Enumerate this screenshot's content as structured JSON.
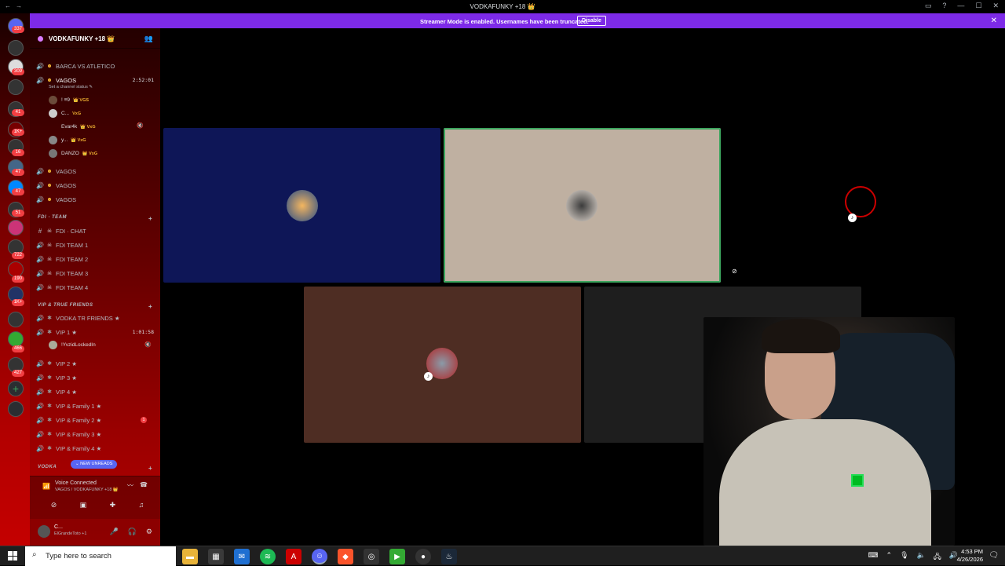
{
  "window": {
    "title": "VODKAFUNKY +18 👑",
    "controls": [
      "▭",
      "?",
      "—",
      "☐",
      "✕"
    ]
  },
  "banner": {
    "text": "Streamer Mode is enabled. Usernames have been truncated.",
    "disable_label": "Disable",
    "close": "✕"
  },
  "rail": {
    "badges": [
      "337",
      "309",
      "41",
      "1K+",
      "16",
      "47",
      "47",
      "51",
      "722",
      "190",
      "1K+",
      "466",
      "427"
    ]
  },
  "guild": {
    "name": "VODKAFUNKY +18 👑",
    "invite_icon": "👥"
  },
  "channels": {
    "barca": {
      "label": "BARCA VS ATLETICO"
    },
    "vagos_active": {
      "label": "VAGOS",
      "time": "2:52:01",
      "status": "Set a channel status ✎"
    },
    "vagos_users": [
      {
        "name": "! ≡9",
        "tag": "👑 VGS"
      },
      {
        "name": "C...",
        "tag": "VxG"
      },
      {
        "name": "Evar4k",
        "tag": "👑 VxG"
      },
      {
        "name": "y...",
        "tag": "👑 VxG"
      },
      {
        "name": "DANZO",
        "tag": "👑 VxG"
      }
    ],
    "vagos2": {
      "label": "VAGOS"
    },
    "vagos3": {
      "label": "VAGOS"
    },
    "vagos4": {
      "label": "VAGOS"
    },
    "fdi_category": "FDI · TEAM",
    "fdi_chat": {
      "label": "FDI · CHAT"
    },
    "fdi_1": {
      "label": "FDI TEAM 1"
    },
    "fdi_2": {
      "label": "FDI TEAM 2"
    },
    "fdi_3": {
      "label": "FDI TEAM 3"
    },
    "fdi_4": {
      "label": "FDI TEAM 4"
    },
    "vip_category": "VIP & TRUE FRIENDS",
    "vodka_tr": {
      "label": "VODKA TR FRIENDS ★"
    },
    "vip1": {
      "label": "VIP 1 ★",
      "time": "1:01:58"
    },
    "vip1_user": {
      "name": "!YvzidLockedIn"
    },
    "vip2": {
      "label": "VIP 2 ★"
    },
    "vip3": {
      "label": "VIP 3 ★"
    },
    "vip4": {
      "label": "VIP 4 ★"
    },
    "vipf1": {
      "label": "VIP & Family 1 ★"
    },
    "vipf2": {
      "label": "VIP & Family 2 ★",
      "mention": "1"
    },
    "vipf3": {
      "label": "VIP & Family 3 ★"
    },
    "vipf4": {
      "label": "VIP & Family 4 ★"
    },
    "vodka_category": "VODKA",
    "new_unreads": "⌄ NEW UNREADS"
  },
  "voice_panel": {
    "title": "Voice Connected",
    "subtitle": "VAGOS / VODKAFUNKY +18 👑"
  },
  "user_panel": {
    "name": "C...",
    "status": "ElGrandeToto +1"
  },
  "taskbar": {
    "search_placeholder": "Type here to search",
    "time": "4:53 PM",
    "date": "4/26/2026"
  },
  "colors": {
    "banner": "#7d2ae8",
    "speaking": "#3ba55d",
    "tile_blue": "#0e1657",
    "tile_beige": "#bfb0a1",
    "tile_brown": "#4e2d23",
    "tile_dark": "#1e1e1e"
  }
}
